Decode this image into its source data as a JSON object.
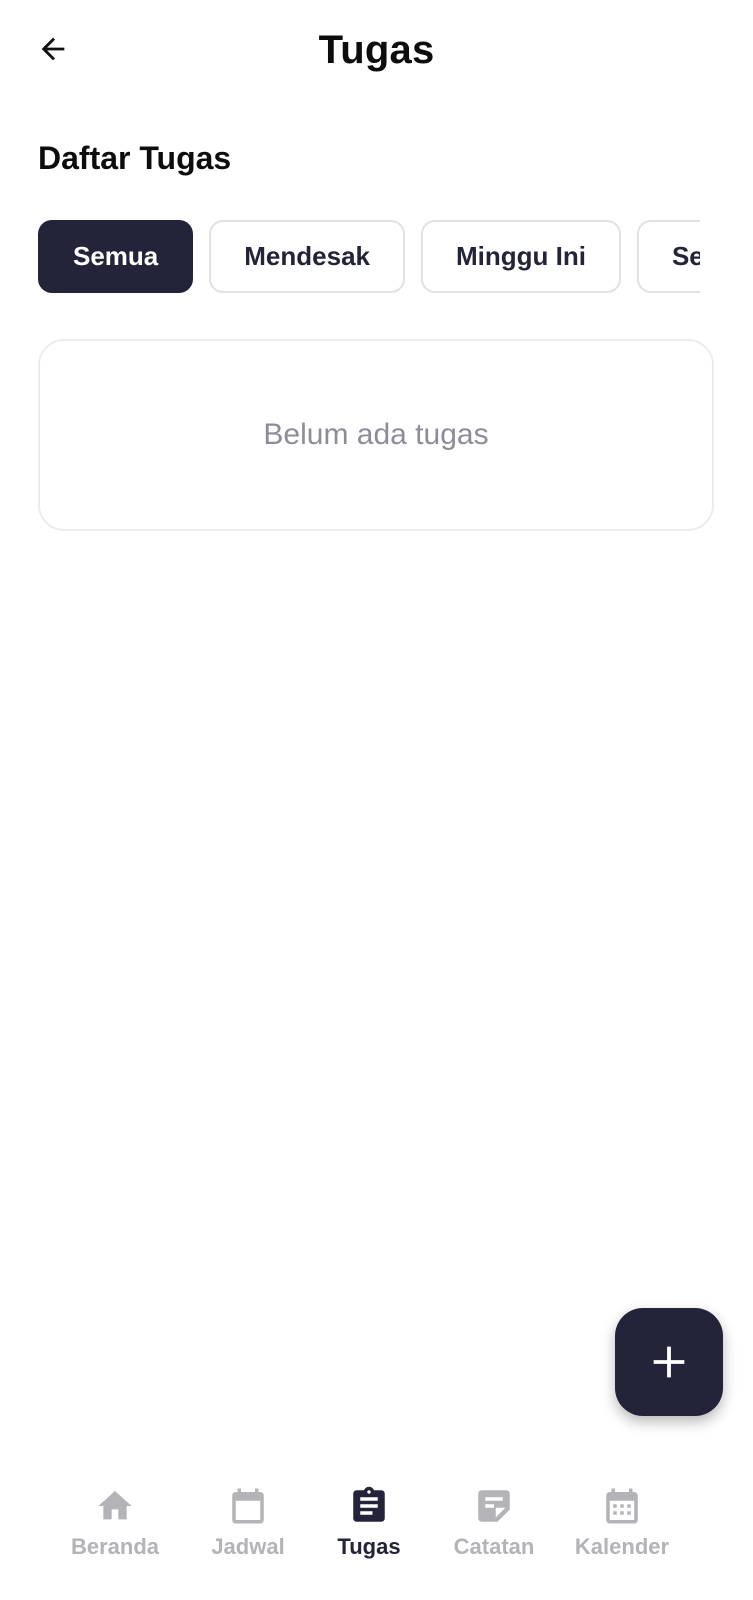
{
  "header": {
    "title": "Tugas",
    "back_icon": "arrow-left-icon"
  },
  "section": {
    "title": "Daftar Tugas"
  },
  "filters": [
    {
      "label": "Semua",
      "active": true
    },
    {
      "label": "Mendesak",
      "active": false
    },
    {
      "label": "Minggu Ini",
      "active": false
    },
    {
      "label": "Selesai",
      "active": false
    }
  ],
  "empty_state": {
    "message": "Belum ada tugas"
  },
  "fab": {
    "icon": "plus-icon"
  },
  "bottom_nav": [
    {
      "label": "Beranda",
      "icon": "home-icon",
      "active": false
    },
    {
      "label": "Jadwal",
      "icon": "calendar-blank-icon",
      "active": false
    },
    {
      "label": "Tugas",
      "icon": "clipboard-icon",
      "active": true
    },
    {
      "label": "Catatan",
      "icon": "note-icon",
      "active": false
    },
    {
      "label": "Kalender",
      "icon": "calendar-grid-icon",
      "active": false
    }
  ],
  "colors": {
    "primary": "#232339",
    "inactive": "#b3b3b8",
    "muted_text": "#8d8d99",
    "border": "#e2e2e6"
  }
}
